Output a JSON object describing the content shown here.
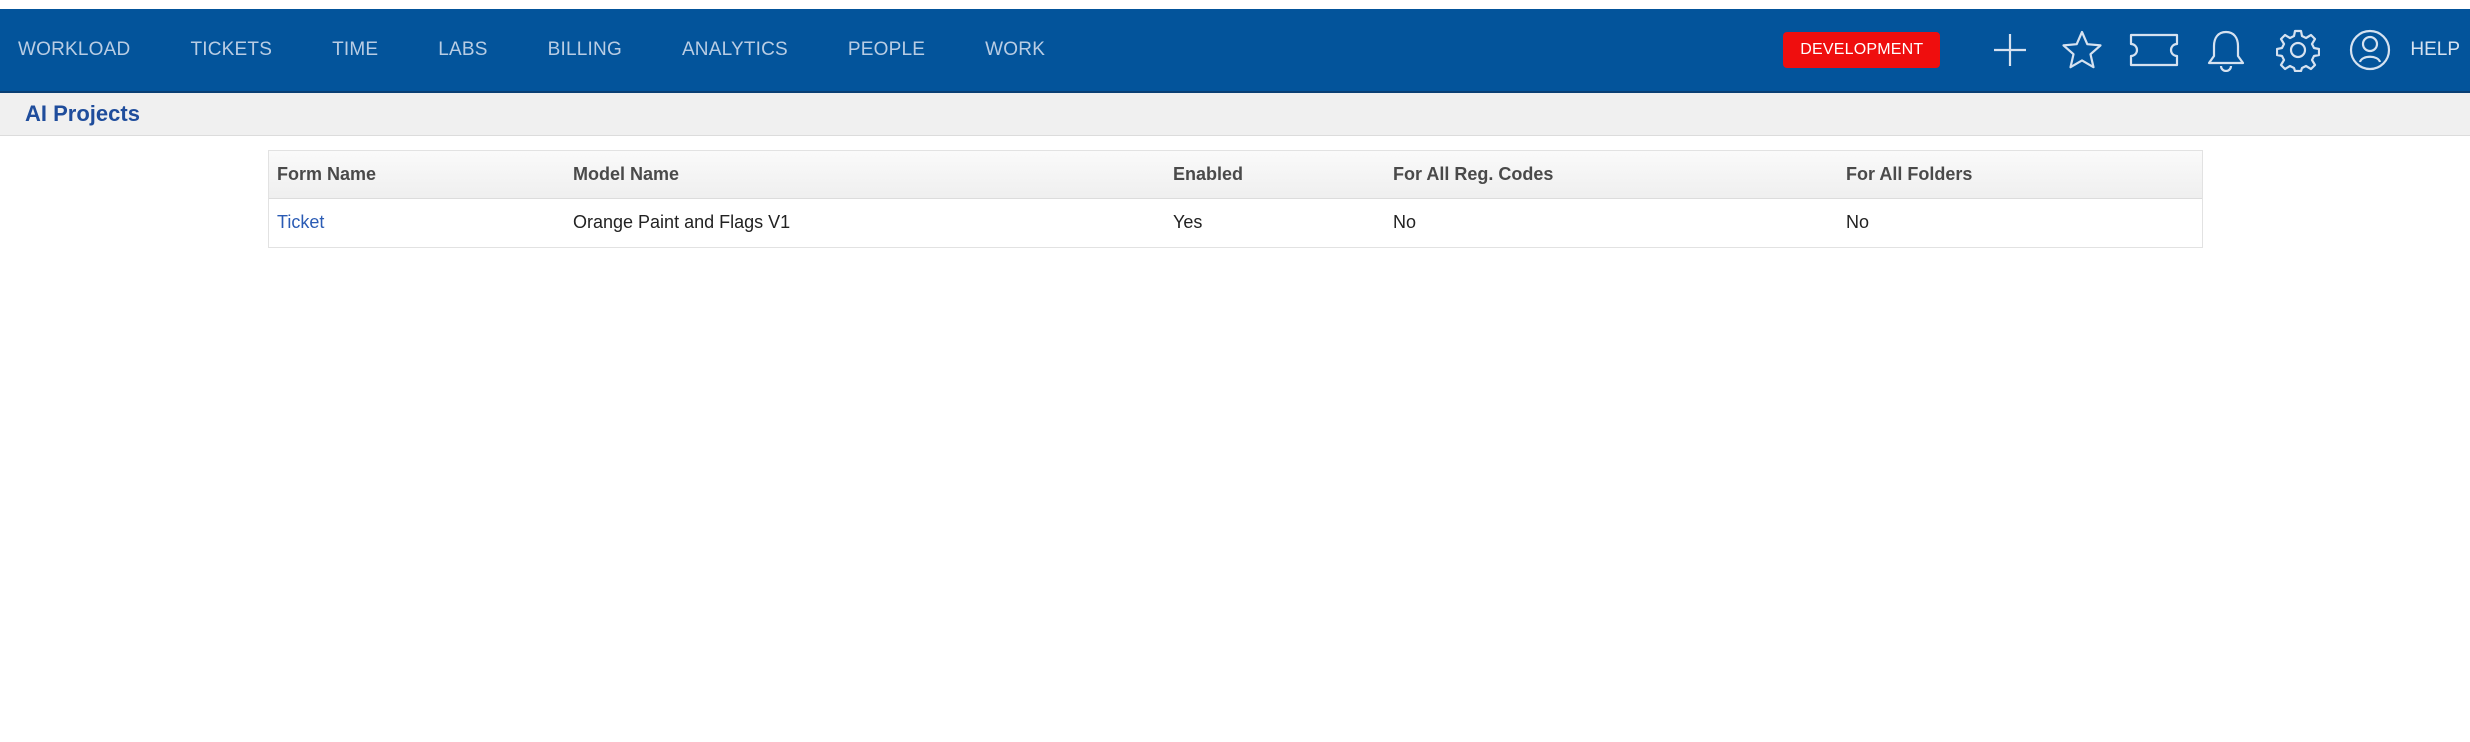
{
  "nav": {
    "items": [
      {
        "label": "WORKLOAD"
      },
      {
        "label": "TICKETS"
      },
      {
        "label": "TIME"
      },
      {
        "label": "LABS"
      },
      {
        "label": "BILLING"
      },
      {
        "label": "ANALYTICS"
      },
      {
        "label": "PEOPLE"
      },
      {
        "label": "WORK"
      }
    ],
    "environment_badge": "DEVELOPMENT",
    "icons": [
      "plus-icon",
      "star-icon",
      "ticket-icon",
      "bell-icon",
      "gear-icon",
      "user-icon"
    ],
    "help_label": "HELP"
  },
  "page": {
    "title": "AI Projects"
  },
  "table": {
    "columns": [
      "Form Name",
      "Model Name",
      "Enabled",
      "For All Reg. Codes",
      "For All Folders"
    ],
    "rows": [
      {
        "form_name": "Ticket",
        "model_name": "Orange Paint and Flags V1",
        "enabled": "Yes",
        "for_all_reg_codes": "No",
        "for_all_folders": "No"
      }
    ]
  },
  "colors": {
    "navbar": "#03549b",
    "badge": "#ef0e0e",
    "title": "#1f4d9c",
    "link": "#2a5bb4"
  }
}
